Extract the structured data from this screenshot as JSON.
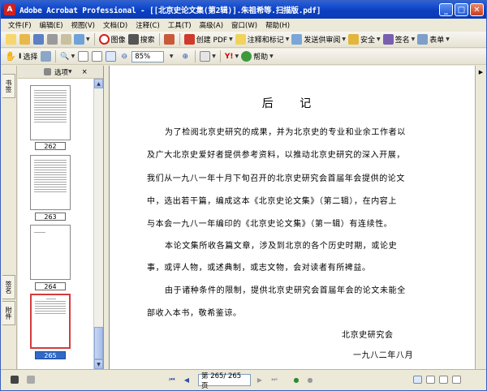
{
  "window": {
    "title": "Adobe Acrobat Professional - [[北京史论文集(第2辑)].朱祖希等.扫描版.pdf]"
  },
  "menubar": {
    "items": [
      "文件(F)",
      "编辑(E)",
      "视图(V)",
      "文档(D)",
      "注释(C)",
      "工具(T)",
      "高级(A)",
      "窗口(W)",
      "帮助(H)"
    ]
  },
  "toolbar1": {
    "tuxiang": "图像",
    "sousuo": "搜索",
    "create_pdf": "创建 PDF",
    "comment_mark": "注释和标记",
    "send_review": "发送供审阅",
    "security": "安全",
    "sign": "签名",
    "form": "表单"
  },
  "toolbar2": {
    "select": "选择",
    "zoom": "85%",
    "help": "帮助"
  },
  "leftpanel": {
    "tabs": [
      "书签",
      "签名",
      "附件"
    ],
    "options": "选项",
    "thumbnails": [
      "262",
      "263",
      "264",
      "265"
    ]
  },
  "document": {
    "title": "后 记",
    "lines": [
      "为了检阅北京史研究的成果，并为北京史的专业和业余工作者以",
      "及广大北京史爱好者提供参考资料，以推动北京史研究的深入开展，",
      "我们从一九八一年十月下旬召开的北京史研究会首届年会提供的论文",
      "中，选出若干篇，编成这本《北京史论文集》（第二辑），在内容上",
      "与本会一九八一年编印的《北京史论文集》（第一辑）有连续性。",
      "本论文集所收各篇文章，涉及到北京的各个历史时期，或论史",
      "事，或评人物，或述典制，或志文物，会对读者有所裨益。",
      "由于诸种条件的限制，提供北京史研究会首届年会的论文未能全",
      "部收入本书，敬希鉴谅。",
      "北京史研究会",
      "一九八二年八月"
    ]
  },
  "statusbar": {
    "page": "第 265/ 265 页"
  }
}
